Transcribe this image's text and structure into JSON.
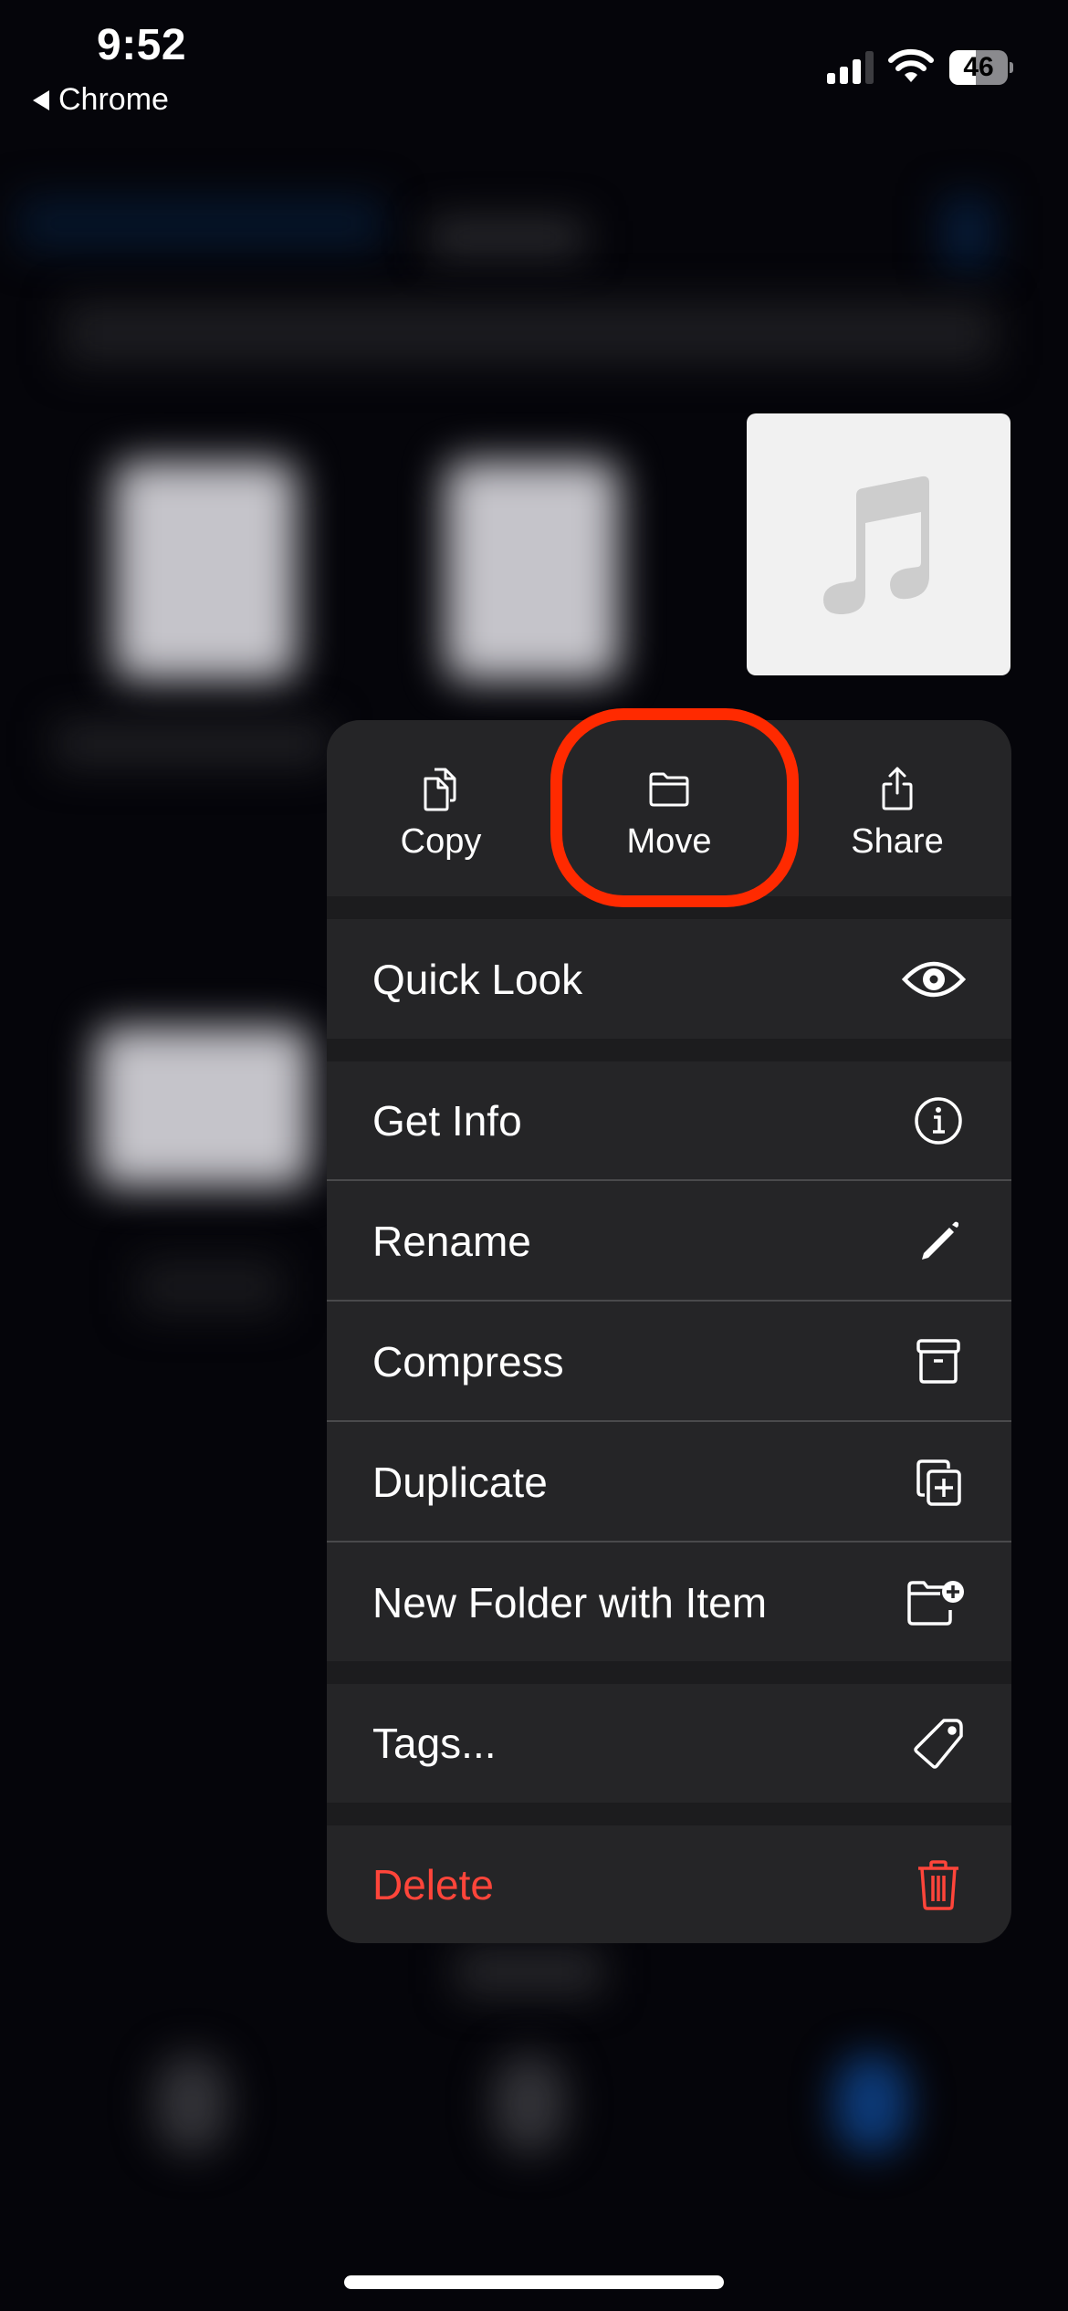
{
  "status_bar": {
    "time": "9:52",
    "back_app": "Chrome",
    "signal_bars_active": 3,
    "signal_bars_total": 4,
    "battery_percent": "46"
  },
  "preview": {
    "file_icon": "music-note-icon"
  },
  "menu": {
    "top_actions": [
      {
        "label": "Copy",
        "icon": "copy-icon"
      },
      {
        "label": "Move",
        "icon": "folder-icon"
      },
      {
        "label": "Share",
        "icon": "share-icon"
      }
    ],
    "items": [
      {
        "label": "Quick Look",
        "icon": "eye-icon"
      },
      {
        "label": "Get Info",
        "icon": "info-icon"
      },
      {
        "label": "Rename",
        "icon": "pencil-icon"
      },
      {
        "label": "Compress",
        "icon": "archive-box-icon"
      },
      {
        "label": "Duplicate",
        "icon": "duplicate-icon"
      },
      {
        "label": "New Folder with Item",
        "icon": "folder-plus-icon"
      },
      {
        "label": "Tags...",
        "icon": "tag-icon"
      },
      {
        "label": "Delete",
        "icon": "trash-icon",
        "destructive": true
      }
    ],
    "destructive_color": "#ff453a"
  },
  "annotation": {
    "highlight": "Move",
    "color": "#ff2a00"
  }
}
